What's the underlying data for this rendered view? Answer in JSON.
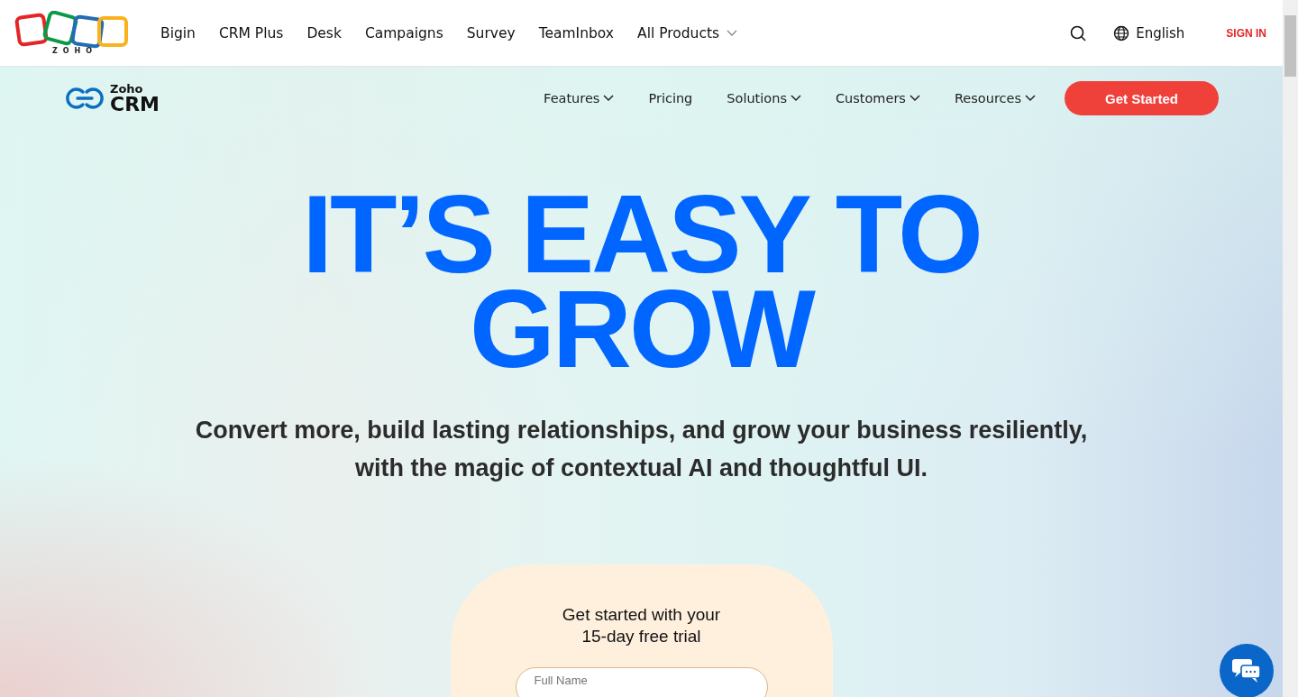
{
  "top_bar": {
    "logo_text": "ZOHO",
    "products": [
      {
        "label": "Bigin",
        "dropdown": false
      },
      {
        "label": "CRM Plus",
        "dropdown": false
      },
      {
        "label": "Desk",
        "dropdown": false
      },
      {
        "label": "Campaigns",
        "dropdown": false
      },
      {
        "label": "Survey",
        "dropdown": false
      },
      {
        "label": "TeamInbox",
        "dropdown": false
      },
      {
        "label": "All Products",
        "dropdown": true
      }
    ],
    "language": "English",
    "sign_in": "SIGN IN"
  },
  "crm_nav": {
    "brand_small": "Zoho",
    "brand_large": "CRM",
    "items": [
      {
        "label": "Features",
        "dropdown": true
      },
      {
        "label": "Pricing",
        "dropdown": false
      },
      {
        "label": "Solutions",
        "dropdown": true
      },
      {
        "label": "Customers",
        "dropdown": true
      },
      {
        "label": "Resources",
        "dropdown": true
      }
    ],
    "cta": "Get Started"
  },
  "hero": {
    "heading_lines": [
      "IT’S EASY TO",
      "GROW"
    ],
    "subtitle_lines": [
      "Convert more, build lasting relationships, and grow your business resiliently,",
      "with the magic of contextual AI and thoughtful UI."
    ]
  },
  "signup_card": {
    "title_lines": [
      "Get started with your",
      "15-day free trial"
    ],
    "fields": [
      {
        "placeholder": "Full Name"
      }
    ]
  }
}
